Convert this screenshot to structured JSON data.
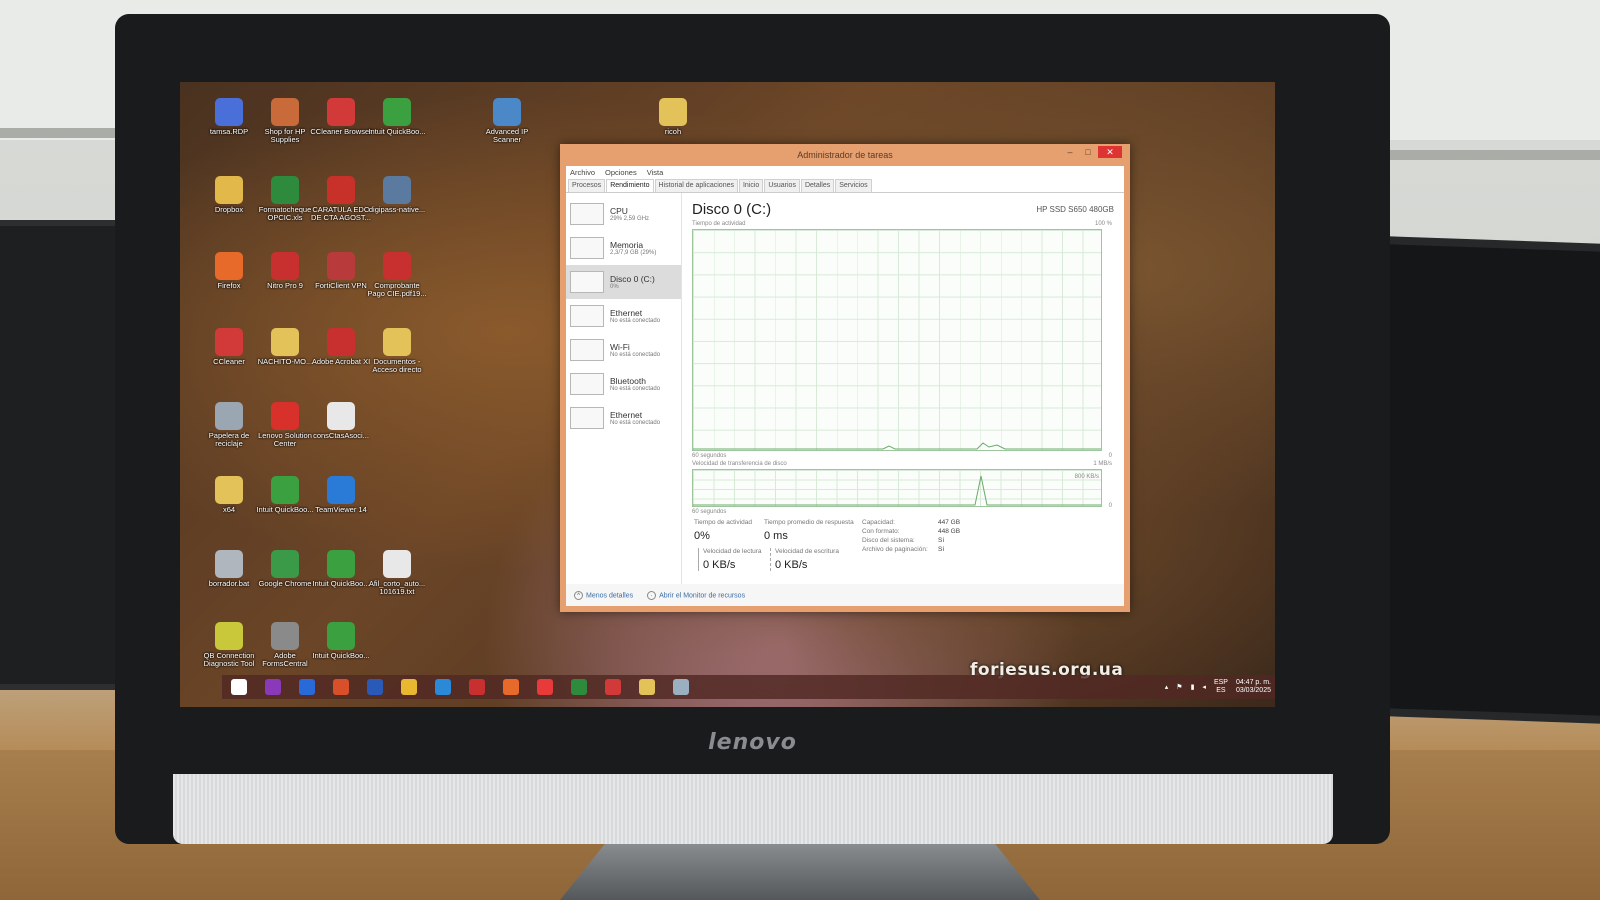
{
  "desktop_icons": [
    {
      "label": "tamsa.RDP",
      "color": "#4a6fd8"
    },
    {
      "label": "Shop for HP Supplies",
      "color": "#c86a3a"
    },
    {
      "label": "CCleaner Browser",
      "color": "#d23a3a"
    },
    {
      "label": "Intuit QuickBoo...",
      "color": "#3aa040"
    },
    {
      "label": "Advanced IP Scanner",
      "color": "#4a88c8"
    },
    {
      "label": "ricoh",
      "color": "#e3c25a"
    },
    {
      "label": "Dropbox",
      "color": "#e3b84a"
    },
    {
      "label": "Formatocheque OPCIC.xls",
      "color": "#2e8b3e"
    },
    {
      "label": "CARATULA EDO DE CTA AGOST...",
      "color": "#c8302a"
    },
    {
      "label": "digipass-native...",
      "color": "#5a7aa0"
    },
    {
      "label": "Firefox",
      "color": "#e86a2a"
    },
    {
      "label": "Nitro Pro 9",
      "color": "#c83030"
    },
    {
      "label": "FortiClient VPN",
      "color": "#b83a3a"
    },
    {
      "label": "Comprobante Pago CIE.pdf19...",
      "color": "#c83030"
    },
    {
      "label": "CCleaner",
      "color": "#d23a3a"
    },
    {
      "label": "NACHITO-MO...",
      "color": "#e3c25a"
    },
    {
      "label": "Adobe Acrobat XI",
      "color": "#c83030"
    },
    {
      "label": "Documentos - Acceso directo",
      "color": "#e3c25a"
    },
    {
      "label": "Papelera de reciclaje",
      "color": "#9aa6b2"
    },
    {
      "label": "Lenovo Solution Center",
      "color": "#d8302a"
    },
    {
      "label": "consCtasAsoci...",
      "color": "#e8e8e8"
    },
    {
      "label": "x64",
      "color": "#e3c25a"
    },
    {
      "label": "Intuit QuickBoo...",
      "color": "#3aa040"
    },
    {
      "label": "TeamViewer 14",
      "color": "#2a7ad8"
    },
    {
      "label": "borrador.bat",
      "color": "#b0b6be"
    },
    {
      "label": "Google Chrome",
      "color": "#3a9a48"
    },
    {
      "label": "Intuit QuickBoo...",
      "color": "#3aa040"
    },
    {
      "label": "Afil_corto_auto... 101619.txt",
      "color": "#e8e8e8"
    },
    {
      "label": "QB Connection Diagnostic Tool",
      "color": "#c8c83a"
    },
    {
      "label": "Adobe FormsCentral",
      "color": "#8a8a8a"
    },
    {
      "label": "Intuit QuickBoo...",
      "color": "#3aa040"
    }
  ],
  "task_manager": {
    "title": "Administrador de tareas",
    "menu": [
      "Archivo",
      "Opciones",
      "Vista"
    ],
    "tabs": [
      "Procesos",
      "Rendimiento",
      "Historial de aplicaciones",
      "Inicio",
      "Usuarios",
      "Detalles",
      "Servicios"
    ],
    "active_tab": "Rendimiento",
    "resources": [
      {
        "name": "CPU",
        "sub": "29% 2,59 GHz"
      },
      {
        "name": "Memoria",
        "sub": "2,3/7,9 GB (29%)"
      },
      {
        "name": "Disco 0 (C:)",
        "sub": "0%",
        "selected": true
      },
      {
        "name": "Ethernet",
        "sub": "No está conectado"
      },
      {
        "name": "Wi-Fi",
        "sub": "No está conectado"
      },
      {
        "name": "Bluetooth",
        "sub": "No está conectado"
      },
      {
        "name": "Ethernet",
        "sub": "No está conectado"
      }
    ],
    "disk_title": "Disco 0 (C:)",
    "disk_model": "HP SSD S650 480GB",
    "chart1_label": "Tiempo de actividad",
    "chart1_max": "100 %",
    "chart1_time": "60 segundos",
    "chart1_min": "0",
    "chart2_label": "Velocidad de transferencia de disco",
    "chart2_max": "1 MB/s",
    "chart2_mid": "800 KB/s",
    "chart2_time": "60 segundos",
    "chart2_min": "0",
    "stats": {
      "active_time_label": "Tiempo de actividad",
      "active_time_value": "0%",
      "response_label": "Tiempo promedio de respuesta",
      "response_value": "0 ms",
      "read_label": "Velocidad de lectura",
      "read_value": "0 KB/s",
      "write_label": "Velocidad de escritura",
      "write_value": "0 KB/s"
    },
    "props": [
      {
        "k": "Capacidad:",
        "v": "447 GB"
      },
      {
        "k": "Con formato:",
        "v": "448 GB"
      },
      {
        "k": "Disco del sistema:",
        "v": "Sí"
      },
      {
        "k": "Archivo de paginación:",
        "v": "Sí"
      }
    ],
    "footer_less": "Menos detalles",
    "footer_monitor": "Abrir el Monitor de recursos"
  },
  "taskbar": {
    "apps": [
      {
        "name": "start-icon",
        "color": "#ffffff"
      },
      {
        "name": "onenote-icon",
        "color": "#8a3ab8"
      },
      {
        "name": "outlook-icon",
        "color": "#2a6ad8"
      },
      {
        "name": "powerpoint-icon",
        "color": "#d8502a"
      },
      {
        "name": "word-icon",
        "color": "#2a5ab8"
      },
      {
        "name": "chrome-icon",
        "color": "#e8b830"
      },
      {
        "name": "ie-icon",
        "color": "#2a8ad8"
      },
      {
        "name": "forticlient-icon",
        "color": "#c83030"
      },
      {
        "name": "firefox-icon",
        "color": "#e86a2a"
      },
      {
        "name": "anydesk-icon",
        "color": "#e83a3a"
      },
      {
        "name": "excel-icon",
        "color": "#2e8b3e"
      },
      {
        "name": "ccleaner-icon",
        "color": "#d23a3a"
      },
      {
        "name": "explorer-icon",
        "color": "#e3c25a"
      },
      {
        "name": "task-manager-icon",
        "color": "#9ab0c0"
      }
    ],
    "watermark": "forjesus.org.ua",
    "lang_top": "ESP",
    "lang_bottom": "ES",
    "time": "04:47 p. m.",
    "date": "03/03/2025"
  },
  "brand": "lenovo",
  "colors": {
    "accent": "#e6a070",
    "graph_border": "#9dc69d"
  }
}
